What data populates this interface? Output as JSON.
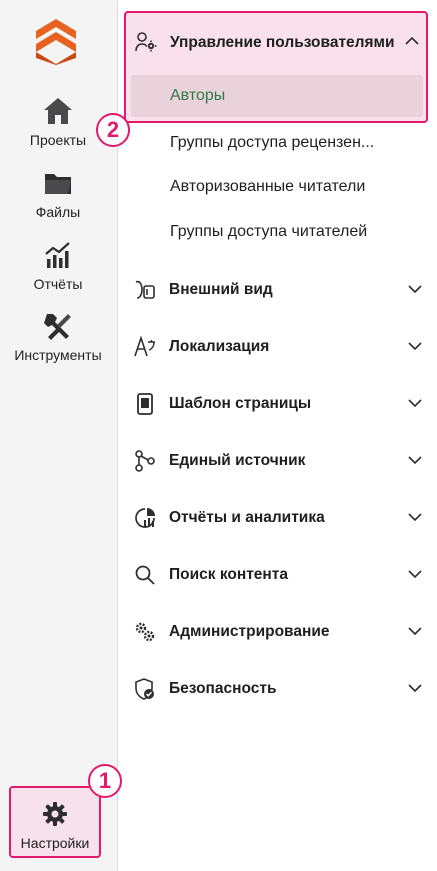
{
  "rail": {
    "items": [
      {
        "label": "Проекты",
        "icon": "home-icon"
      },
      {
        "label": "Файлы",
        "icon": "folder-icon"
      },
      {
        "label": "Отчёты",
        "icon": "bar-chart-icon"
      },
      {
        "label": "Инструменты",
        "icon": "tools-icon"
      }
    ],
    "settings": {
      "label": "Настройки",
      "icon": "gear-icon"
    }
  },
  "callouts": [
    "1",
    "2"
  ],
  "menu": {
    "user_management": {
      "label": "Управление пользователями",
      "expanded": true,
      "selected_item": "Авторы",
      "items": [
        "Группы доступа рецензен...",
        "Авторизованные читатели",
        "Группы доступа читателей"
      ]
    },
    "sections": [
      {
        "label": "Внешний вид",
        "icon": "brush-icon"
      },
      {
        "label": "Локализация",
        "icon": "translate-icon"
      },
      {
        "label": "Шаблон страницы",
        "icon": "page-template-icon"
      },
      {
        "label": "Единый источник",
        "icon": "branch-icon"
      },
      {
        "label": "Отчёты и аналитика",
        "icon": "pie-chart-icon"
      },
      {
        "label": "Поиск контента",
        "icon": "search-icon"
      },
      {
        "label": "Администрирование",
        "icon": "admin-gears-icon"
      },
      {
        "label": "Безопасность",
        "icon": "shield-check-icon"
      }
    ]
  },
  "colors": {
    "accent": "#e3196a",
    "selected_bg": "#ead2da",
    "selected_text": "#2f7a4a",
    "logo_orange": "#e8621f"
  }
}
